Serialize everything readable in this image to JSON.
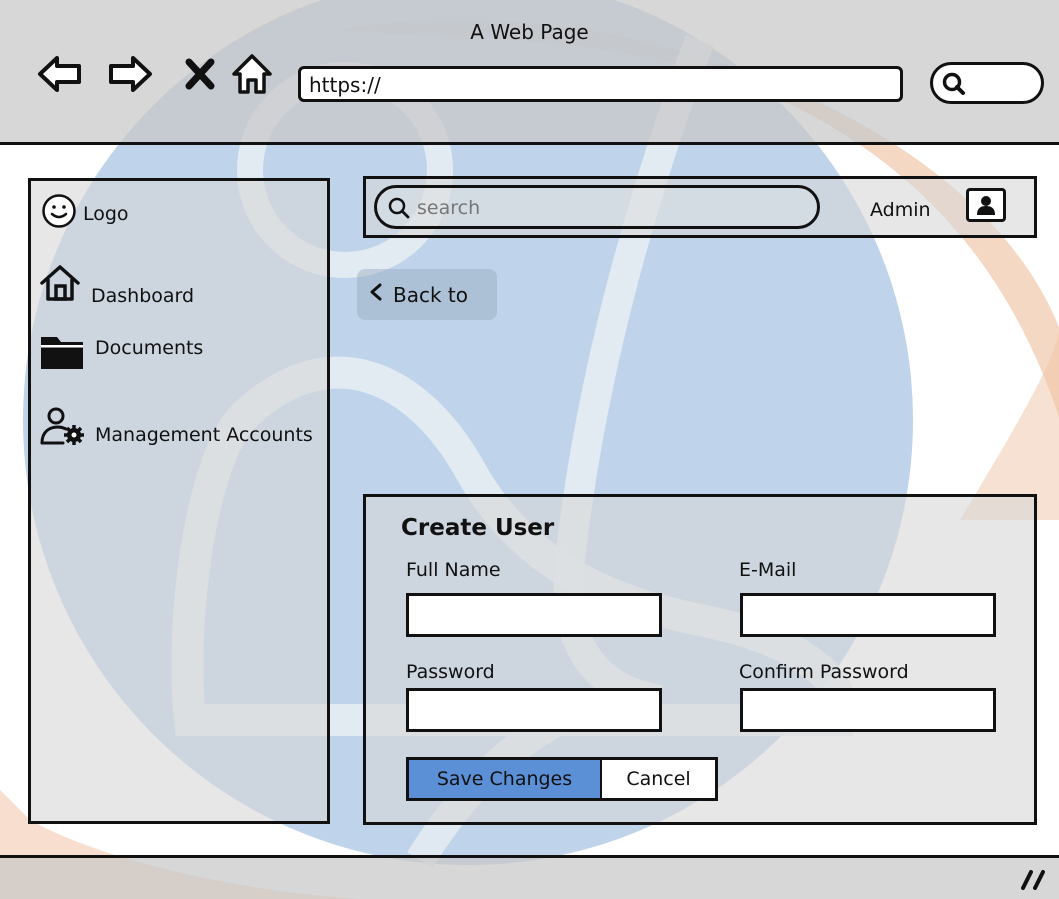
{
  "browser": {
    "title": "A Web Page",
    "url": "https://",
    "nav_icons": [
      "back-arrow-icon",
      "forward-arrow-icon",
      "close-icon",
      "home-icon"
    ],
    "search_icon": "search-icon"
  },
  "sidebar": {
    "logo_label": "Logo",
    "items": [
      {
        "label": "Dashboard",
        "icon": "home-icon"
      },
      {
        "label": "Documents",
        "icon": "folder-icon"
      },
      {
        "label": "Management Accounts",
        "icon": "user-gear-icon"
      }
    ]
  },
  "header": {
    "search_placeholder": "search",
    "user_label": "Admin",
    "avatar_icon": "user-avatar-icon"
  },
  "back": {
    "label": "Back to",
    "icon": "chevron-left-icon"
  },
  "form": {
    "title": "Create User",
    "fields": {
      "full_name_label": "Full Name",
      "email_label": "E-Mail",
      "password_label": "Password",
      "confirm_password_label": "Confirm Password"
    },
    "save_label": "Save Changes",
    "cancel_label": "Cancel"
  },
  "colors": {
    "primary_button": "#5b8fd6",
    "watermark_blue": "#a9c5e3",
    "watermark_orange": "#f0c3a5",
    "chrome_gray": "#c8c8c8"
  }
}
